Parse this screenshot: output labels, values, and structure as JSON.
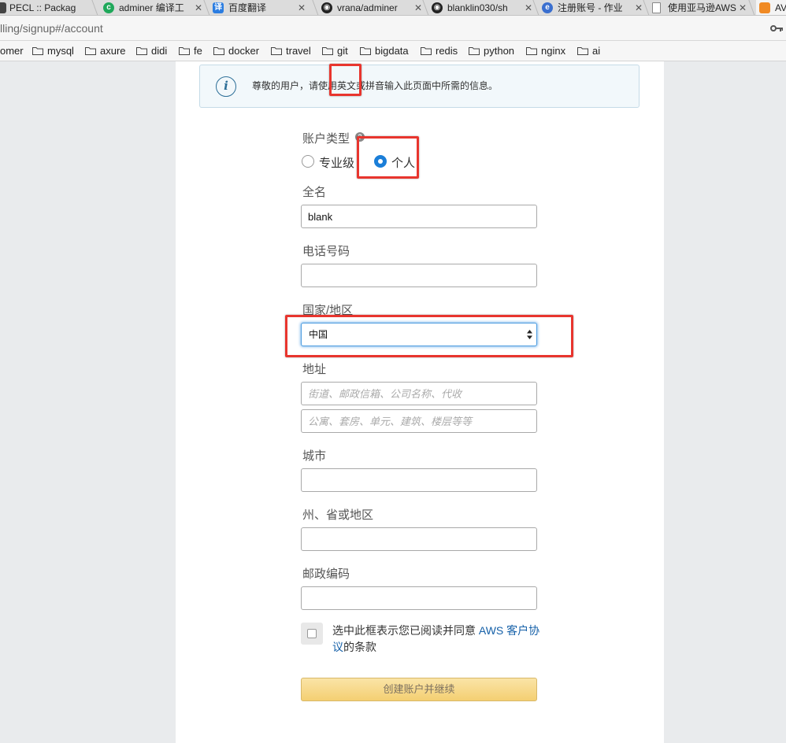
{
  "browser": {
    "tabs": [
      {
        "title": "PECL :: Packag",
        "icon": "pecl-icon"
      },
      {
        "title": "adminer 编译工",
        "icon": "c-logo-icon",
        "color": "#1fa85a"
      },
      {
        "title": "百度翻译",
        "icon": "translate-icon",
        "glyph": "译",
        "color": "#2b7de1"
      },
      {
        "title": "vrana/adminer",
        "icon": "github-icon"
      },
      {
        "title": "blanklin030/sh",
        "icon": "github-icon"
      },
      {
        "title": "注册账号 - 作业",
        "icon": "e-logo-icon",
        "color": "#3a6fcf"
      },
      {
        "title": "使用亚马逊AWS",
        "icon": "document-icon"
      },
      {
        "title": "AV",
        "icon": "aws-cube-icon",
        "color": "#f08a24"
      }
    ],
    "url": "lling/signup#/account",
    "bookmarks": [
      "omer",
      "mysql",
      "axure",
      "didi",
      "fe",
      "docker",
      "travel",
      "git",
      "bigdata",
      "redis",
      "python",
      "nginx",
      "ai"
    ]
  },
  "notice": {
    "icon": "info-icon",
    "text": "尊敬的用户，请使用英文或拼音输入此页面中所需的信息。"
  },
  "form": {
    "account_type_label": "账户类型",
    "account_types": [
      {
        "label": "专业级",
        "checked": false
      },
      {
        "label": "个人",
        "checked": true
      }
    ],
    "full_name_label": "全名",
    "full_name_value": "blank",
    "phone_label": "电话号码",
    "phone_value": "",
    "country_label": "国家/地区",
    "country_value": "中国",
    "address_label": "地址",
    "address_line1_placeholder": "街道、邮政信箱、公司名称、代收",
    "address_line2_placeholder": "公寓、套房、单元、建筑、楼层等等",
    "city_label": "城市",
    "city_value": "",
    "state_label": "州、省或地区",
    "state_value": "",
    "postal_label": "邮政编码",
    "postal_value": "",
    "agreement_prefix": "选中此框表示您已阅读并同意 ",
    "agreement_link": "AWS 客户协议",
    "agreement_suffix": "的条款",
    "agreement_checked": false,
    "submit_label": "创建账户并继续"
  },
  "colors": {
    "highlight": "#e8352e",
    "link": "#1560a8",
    "radio_selected": "#1b7ed8",
    "button_gradient_top": "#fae4a7",
    "button_gradient_bottom": "#f4cf72"
  }
}
